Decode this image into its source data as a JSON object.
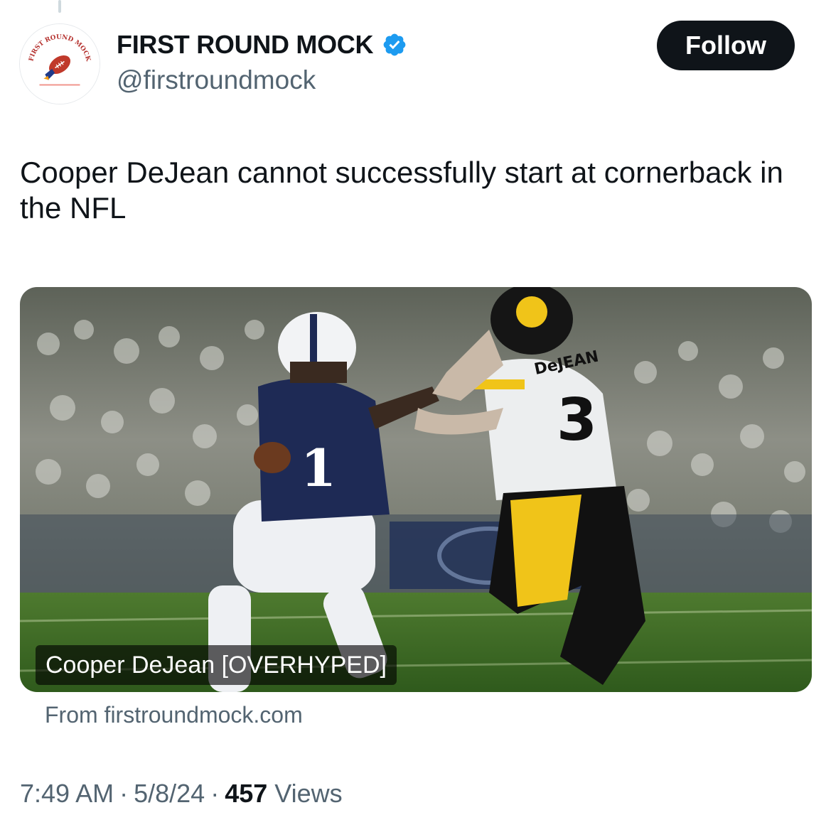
{
  "author": {
    "display_name": "FIRST ROUND MOCK",
    "handle": "@firstroundmock",
    "verified": true,
    "avatar_logo_text": "FIRST ROUND MOCK",
    "avatar_icon": "football-rocket-logo",
    "verified_icon": "verified-badge-icon"
  },
  "follow_button": {
    "label": "Follow"
  },
  "tweet": {
    "text": "Cooper DeJean cannot successfully start at cornerback in the NFL"
  },
  "link_card": {
    "title": "Cooper DeJean [OVERHYPED]",
    "source": "From firstroundmock.com",
    "image_description_icon": "football-photo"
  },
  "meta": {
    "time": "7:49 AM",
    "separator": "·",
    "date": "5/8/24",
    "views_count": "457",
    "views_label": "Views"
  },
  "colors": {
    "text_primary": "#0f1419",
    "text_secondary": "#536471",
    "verified_blue": "#1d9bf0",
    "follow_bg": "#0f1419"
  }
}
